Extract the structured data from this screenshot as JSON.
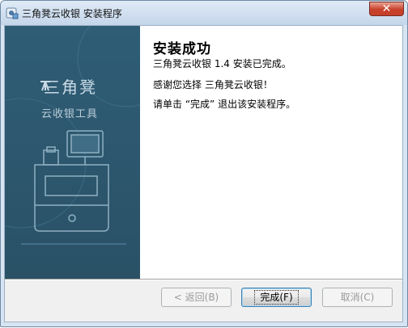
{
  "window": {
    "title": "三角凳云收银 安装程序"
  },
  "sidebar": {
    "brand_name": "三角凳",
    "brand_tagline": "云收银工具"
  },
  "main": {
    "heading": "安装成功",
    "line1": "三角凳云收银 1.4 安装已完成。",
    "line2": "感谢您选择 三角凳云收银！",
    "line3": "请单击 “完成” 退出该安装程序。"
  },
  "buttons": {
    "back": "< 返回(B)",
    "finish": "完成(F)",
    "cancel": "取消(C)"
  },
  "colors": {
    "sidebar_bg": "#2b566c",
    "titlebar": "#c4d6ea",
    "close": "#c7402a"
  }
}
